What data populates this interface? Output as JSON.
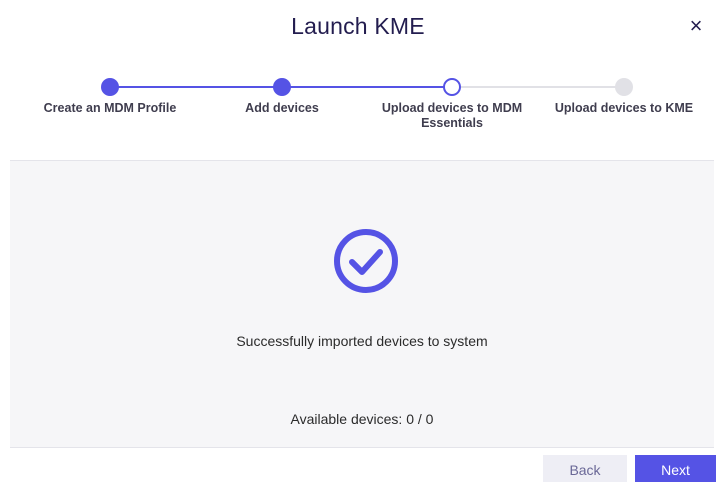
{
  "dialog": {
    "title": "Launch KME",
    "close_label": "×"
  },
  "stepper": {
    "steps": [
      {
        "label": "Create an MDM Profile",
        "state": "done"
      },
      {
        "label": "Add devices",
        "state": "done"
      },
      {
        "label": "Upload devices to MDM Essentials",
        "state": "current"
      },
      {
        "label": "Upload devices to KME",
        "state": "pending"
      }
    ]
  },
  "content": {
    "status_icon": "check-circle-icon",
    "message": "Successfully imported devices to system",
    "available_devices": "Available devices: 0 / 0"
  },
  "footer": {
    "back_label": "Back",
    "next_label": "Next"
  },
  "colors": {
    "accent": "#5553e5",
    "title": "#231d4f",
    "pending": "#e1e1e6",
    "content_bg": "#f6f6f8"
  }
}
